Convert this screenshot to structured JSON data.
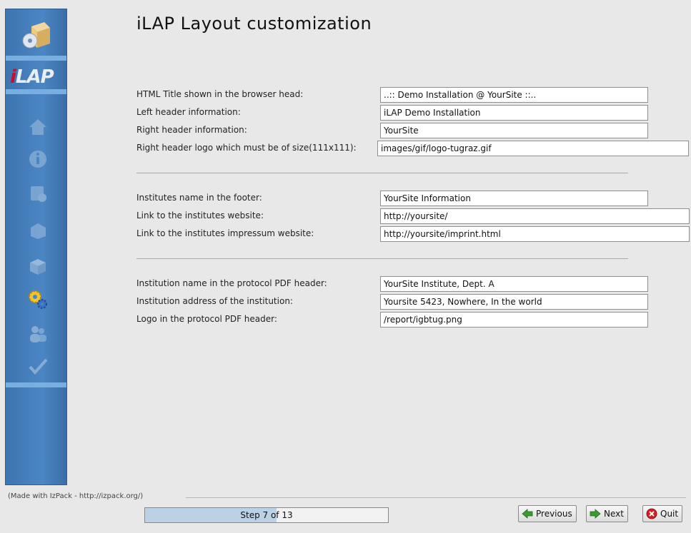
{
  "title": "iLAP Layout customization",
  "logo_text_i": "i",
  "logo_text_lap": "LAP",
  "group1": [
    {
      "label": "HTML Title shown in the browser head:",
      "value": "..:: Demo Installation @ YourSite ::.."
    },
    {
      "label": "Left header information:",
      "value": "iLAP Demo Installation"
    },
    {
      "label": "Right header information:",
      "value": "YourSite"
    },
    {
      "label": "Right header logo which must be of size(111x111):",
      "value": "images/gif/logo-tugraz.gif"
    }
  ],
  "group2": [
    {
      "label": "Institutes name in the footer:",
      "value": "YourSite Information"
    },
    {
      "label": "Link to the institutes website:",
      "value": "http://yoursite/"
    },
    {
      "label": "Link to the institutes impressum website:",
      "value": "http://yoursite/imprint.html"
    }
  ],
  "group3": [
    {
      "label": "Institution name in the protocol PDF header:",
      "value": "YourSite Institute, Dept. A"
    },
    {
      "label": "Institution address of the institution:",
      "value": "Yoursite 5423, Nowhere, In the world"
    },
    {
      "label": "Logo in the protocol PDF header:",
      "value": "/report/igbtug.png"
    }
  ],
  "footer": {
    "made_with": "(Made with IzPack - http://izpack.org/)",
    "progress_text": "Step 7 of 13",
    "progress_fraction": 0.54
  },
  "buttons": {
    "previous": "Previous",
    "next": "Next",
    "quit": "Quit"
  },
  "sidebar_icons": [
    "install-box-icon",
    "home-icon",
    "info-icon",
    "license-icon",
    "packages-icon",
    "box-icon",
    "gears-icon",
    "users-icon",
    "checkmark-icon"
  ],
  "colors": {
    "sidebar": "#4b86c4",
    "accent_band": "#79aee0",
    "logo_red": "#c8102e"
  }
}
